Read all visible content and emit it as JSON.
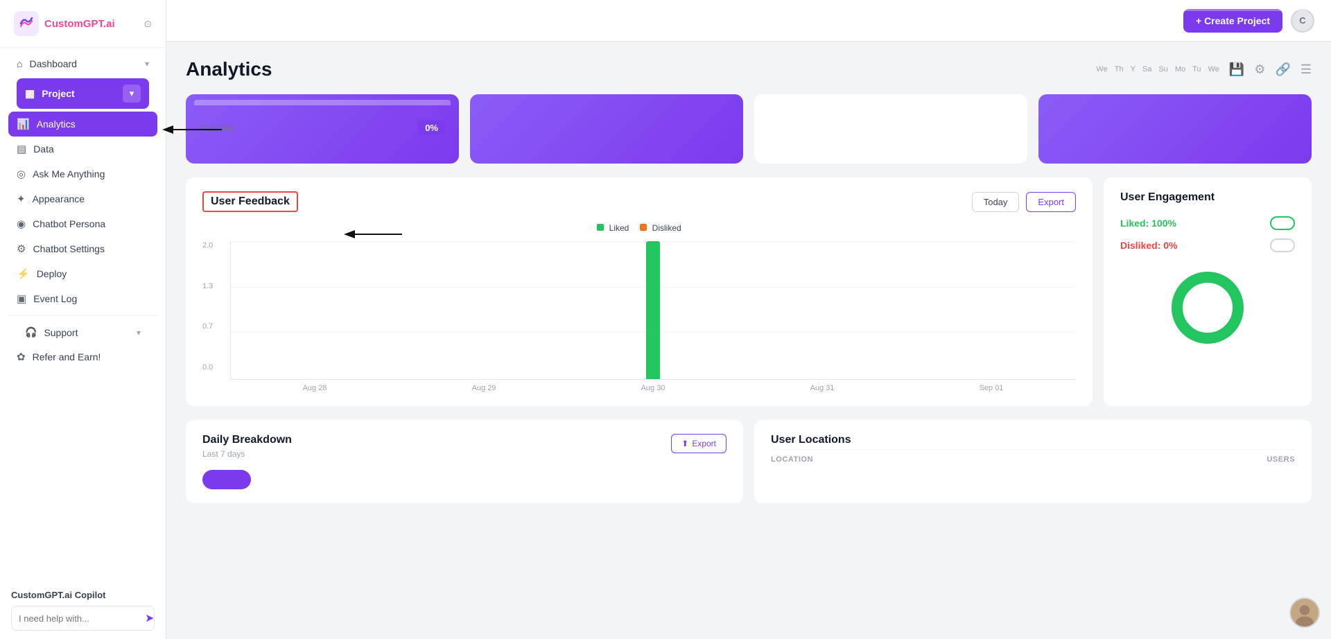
{
  "sidebar": {
    "logo_text": "CustomGPT",
    "logo_suffix": ".ai",
    "nav": {
      "dashboard": "Dashboard",
      "project": "Project",
      "analytics": "Analytics",
      "data": "Data",
      "ask_me": "Ask Me Anything",
      "appearance": "Appearance",
      "chatbot_persona": "Chatbot Persona",
      "chatbot_settings": "Chatbot Settings",
      "deploy": "Deploy",
      "event_log": "Event Log",
      "support": "Support",
      "refer": "Refer and Earn!"
    },
    "copilot_title": "CustomGPT.ai Copilot",
    "copilot_placeholder": "I need help with..."
  },
  "topbar": {
    "create_btn": "+ Create Project",
    "avatar_initial": "C"
  },
  "analytics": {
    "page_title": "Analytics",
    "top_cards": {
      "failures_label": "Failures",
      "failures_value": "0%"
    },
    "user_feedback": {
      "title": "User Feedback",
      "btn_today": "Today",
      "btn_export": "Export",
      "legend_liked": "Liked",
      "legend_disliked": "Disliked",
      "x_labels": [
        "Aug 28",
        "Aug 29",
        "Aug 30",
        "Aug 31",
        "Sep 01"
      ],
      "bar_data": [
        {
          "label": "Aug 28",
          "liked": 0,
          "disliked": 0
        },
        {
          "label": "Aug 29",
          "liked": 0,
          "disliked": 0
        },
        {
          "label": "Aug 30",
          "liked": 2,
          "disliked": 0
        },
        {
          "label": "Aug 31",
          "liked": 0,
          "disliked": 0
        },
        {
          "label": "Sep 01",
          "liked": 0,
          "disliked": 0
        }
      ],
      "y_labels": [
        "2.0",
        "1.3",
        "0.7",
        "0.0"
      ]
    },
    "user_engagement": {
      "title": "User Engagement",
      "liked_label": "Liked: 100%",
      "disliked_label": "Disliked: 0%"
    },
    "daily_breakdown": {
      "title": "Daily Breakdown",
      "subtitle": "Last 7 days",
      "export_btn": "Export"
    },
    "user_locations": {
      "title": "User Locations",
      "col_location": "LOCATION",
      "col_users": "USERS"
    }
  },
  "date_labels": [
    "We",
    "Th",
    "Y",
    "Sa",
    "Su",
    "Mo",
    "Tu",
    "We"
  ]
}
